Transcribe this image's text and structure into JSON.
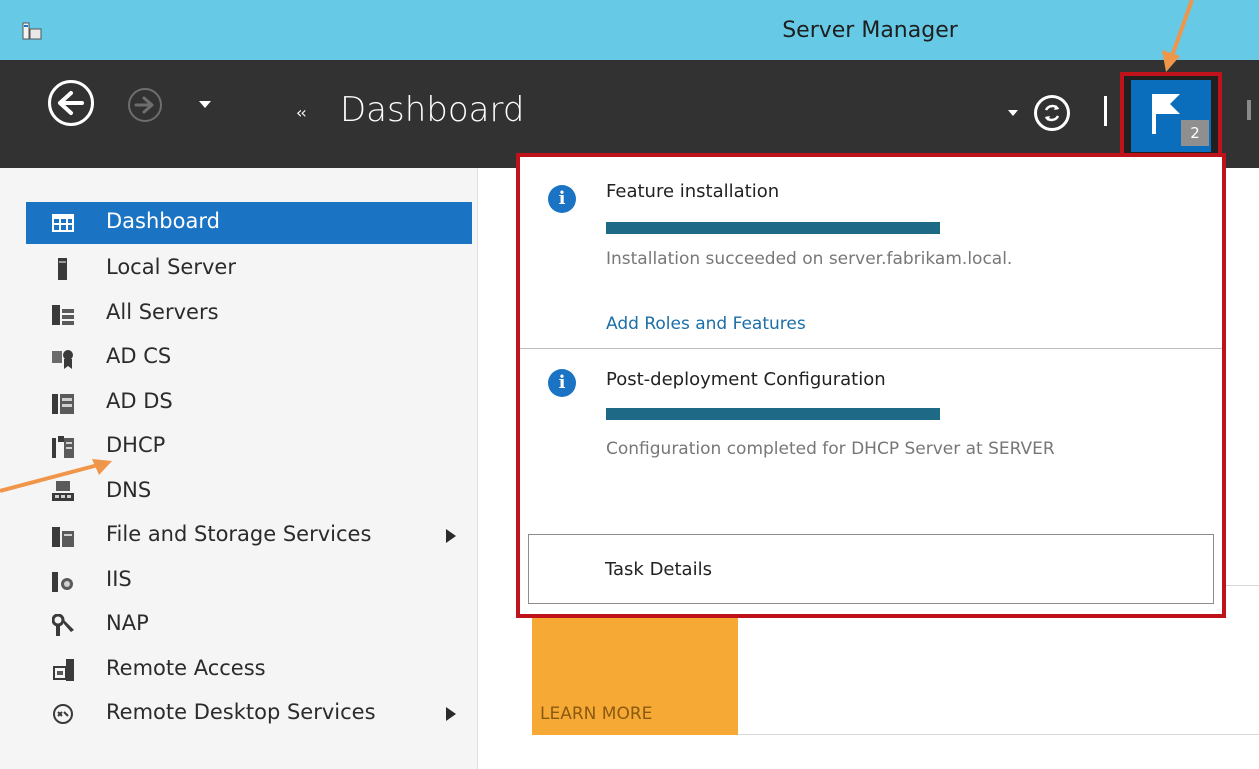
{
  "window": {
    "title": "Server Manager"
  },
  "header": {
    "breadcrumb_arrows": "‹‹",
    "breadcrumb": "Dashboard",
    "notification_count": "2"
  },
  "sidebar": {
    "items": [
      {
        "label": "Dashboard",
        "icon": "dashboard-grid-icon",
        "active": true
      },
      {
        "label": "Local Server",
        "icon": "server-icon"
      },
      {
        "label": "All Servers",
        "icon": "servers-icon"
      },
      {
        "label": "AD CS",
        "icon": "certificate-icon"
      },
      {
        "label": "AD DS",
        "icon": "directory-icon"
      },
      {
        "label": "DHCP",
        "icon": "dhcp-icon"
      },
      {
        "label": "DNS",
        "icon": "dns-icon"
      },
      {
        "label": "File and Storage Services",
        "icon": "file-storage-icon",
        "expandable": true
      },
      {
        "label": "IIS",
        "icon": "iis-icon"
      },
      {
        "label": "NAP",
        "icon": "nap-icon"
      },
      {
        "label": "Remote Access",
        "icon": "remote-access-icon"
      },
      {
        "label": "Remote Desktop Services",
        "icon": "remote-desktop-icon",
        "expandable": true
      }
    ]
  },
  "notifications": [
    {
      "title": "Feature installation",
      "progress": 1.0,
      "message": "Installation succeeded on server.fabrikam.local.",
      "link": "Add Roles and Features"
    },
    {
      "title": "Post-deployment Configuration",
      "progress": 1.0,
      "message": "Configuration completed for DHCP Server at SERVER"
    }
  ],
  "task_details_label": "Task Details",
  "main": {
    "learn_more": "LEARN MORE"
  },
  "colors": {
    "titlebar": "#66c9e6",
    "header": "#323232",
    "accent": "#1b73c4",
    "highlight_border": "#c0121b",
    "annotation_arrow": "#f0964a",
    "tile": "#f7a935"
  }
}
